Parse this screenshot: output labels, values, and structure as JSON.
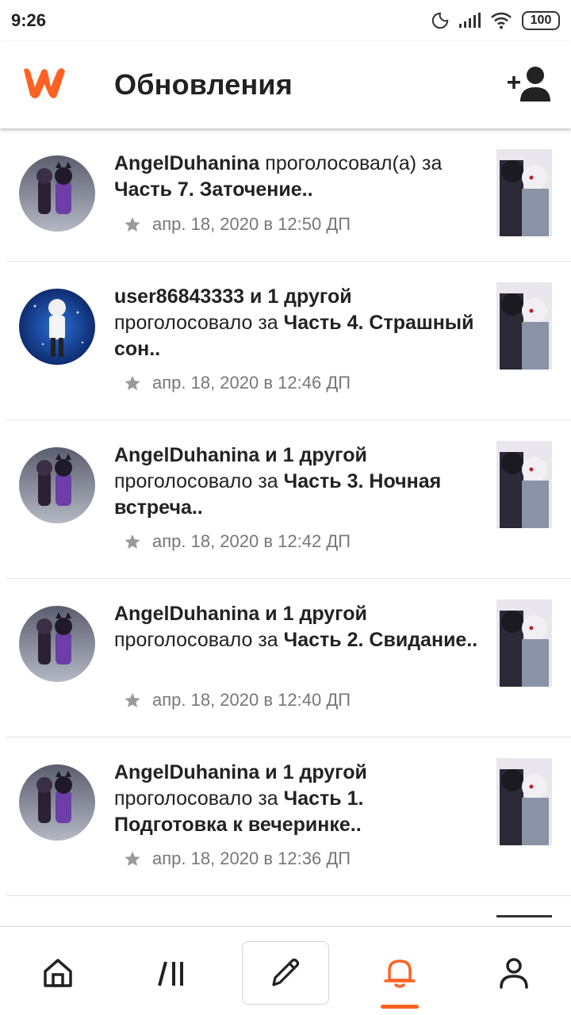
{
  "status_bar": {
    "time": "9:26",
    "battery": "100"
  },
  "header": {
    "title": "Обновления",
    "logo_icon": "wattpad-logo-icon",
    "add_user_icon": "add-user-icon"
  },
  "colors": {
    "brand": "#ff6122",
    "text": "#222222",
    "meta": "#777777"
  },
  "notifications": [
    {
      "user": "AngelDuhanina",
      "extra": "",
      "action": "проголосовал(а) за",
      "story": "Часть 7. Заточение..",
      "time": "апр. 18, 2020 в 12:50 ДП"
    },
    {
      "user": "user86843333",
      "extra": "и 1 другой",
      "action": "проголосовало за",
      "story": "Часть 4. Страшный сон..",
      "time": "апр. 18, 2020 в 12:46 ДП"
    },
    {
      "user": "AngelDuhanina",
      "extra": "и 1 другой",
      "action": "проголосовало за",
      "story": "Часть 3. Ночная встреча..",
      "time": "апр. 18, 2020 в 12:42 ДП"
    },
    {
      "user": "AngelDuhanina",
      "extra": "и 1 другой",
      "action": "проголосовало за",
      "story": "Часть 2. Свидание..",
      "time": "апр. 18, 2020 в 12:40 ДП"
    },
    {
      "user": "AngelDuhanina",
      "extra": "и 1 другой",
      "action": "проголосовало за",
      "story": "Часть 1. Подготовка к вечеринке..",
      "time": "апр. 18, 2020 в 12:36 ДП"
    }
  ],
  "nav": {
    "items": [
      "home-icon",
      "library-icon",
      "write-icon",
      "notifications-icon",
      "profile-icon"
    ],
    "active": "notifications-icon"
  }
}
